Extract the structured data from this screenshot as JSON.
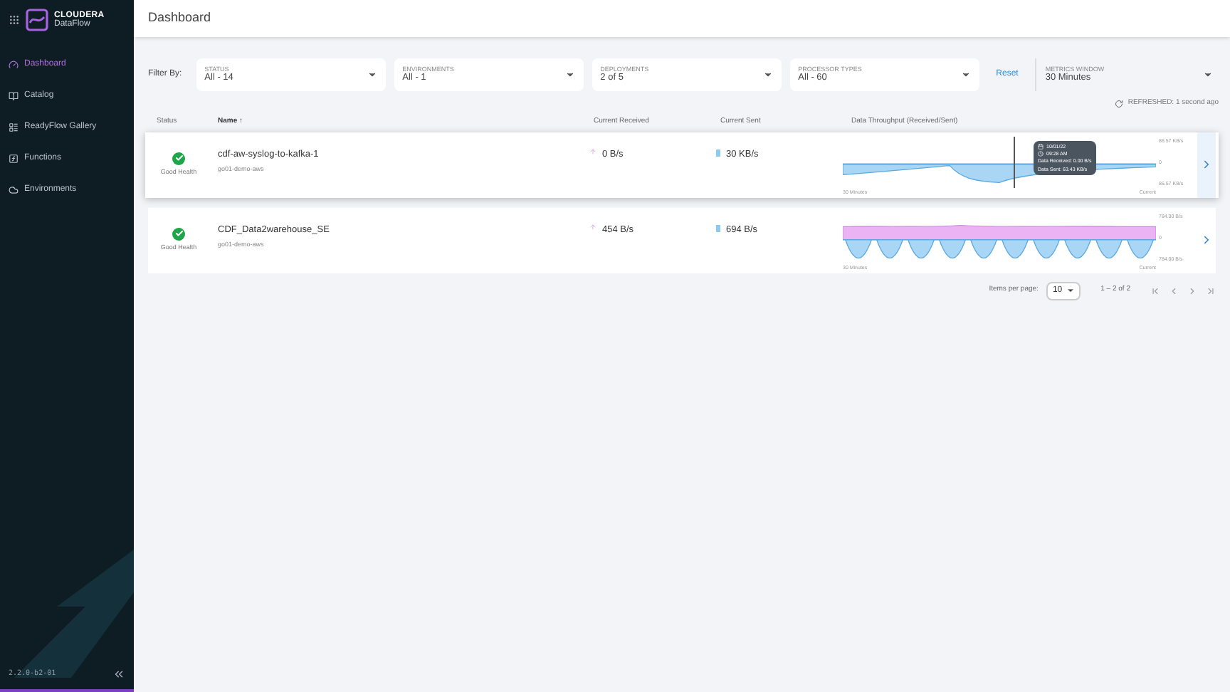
{
  "brand": {
    "name": "CLOUDERA",
    "product": "DataFlow"
  },
  "sidebar": {
    "items": [
      {
        "label": "Dashboard",
        "selected": true
      },
      {
        "label": "Catalog",
        "selected": false
      },
      {
        "label": "ReadyFlow Gallery",
        "selected": false
      },
      {
        "label": "Functions",
        "selected": false
      },
      {
        "label": "Environments",
        "selected": false
      }
    ],
    "version": "2.2.0-b2-01"
  },
  "header": {
    "title": "Dashboard"
  },
  "filters": {
    "label": "Filter By:",
    "items": [
      {
        "label": "STATUS",
        "value": "All - 14"
      },
      {
        "label": "ENVIRONMENTS",
        "value": "All - 1"
      },
      {
        "label": "DEPLOYMENTS",
        "value": "2 of 5"
      },
      {
        "label": "PROCESSOR TYPES",
        "value": "All - 60"
      }
    ],
    "reset": "Reset",
    "metrics_window": {
      "label": "METRICS WINDOW",
      "value": "30 Minutes"
    }
  },
  "refreshed": {
    "label": "REFRESHED:",
    "value": "1 second ago"
  },
  "table": {
    "columns": [
      "Status",
      "Name ↑",
      "Current Received",
      "Current Sent",
      "Data Throughput (Received/Sent)"
    ],
    "rows": [
      {
        "status": "Good Health",
        "name": "cdf-aw-syslog-to-kafka-1",
        "environment": "go01-demo-aws",
        "received": "0 B/s",
        "sent": "30 KB/s",
        "selected": true,
        "axis": [
          "86.57 KB/s",
          "0",
          "86.57 KB/s"
        ],
        "x_start": "30 Minutes",
        "x_end": "Current",
        "tooltip": {
          "date": "10/01/22",
          "time": "09:28 AM",
          "received": "Data Received: 0.00 B/s",
          "sent": "Data Sent: 63.43 KB/s"
        }
      },
      {
        "status": "Good Health",
        "name": "CDF_Data2warehouse_SE",
        "environment": "go01-demo-aws",
        "received": "454 B/s",
        "sent": "694 B/s",
        "selected": false,
        "axis": [
          "784.00 B/s",
          "0",
          "784.00 B/s"
        ],
        "x_start": "30 Minutes",
        "x_end": "Current"
      }
    ]
  },
  "pagination": {
    "label": "Items per page:",
    "per_page": "10",
    "range": "1 – 2 of 2"
  }
}
